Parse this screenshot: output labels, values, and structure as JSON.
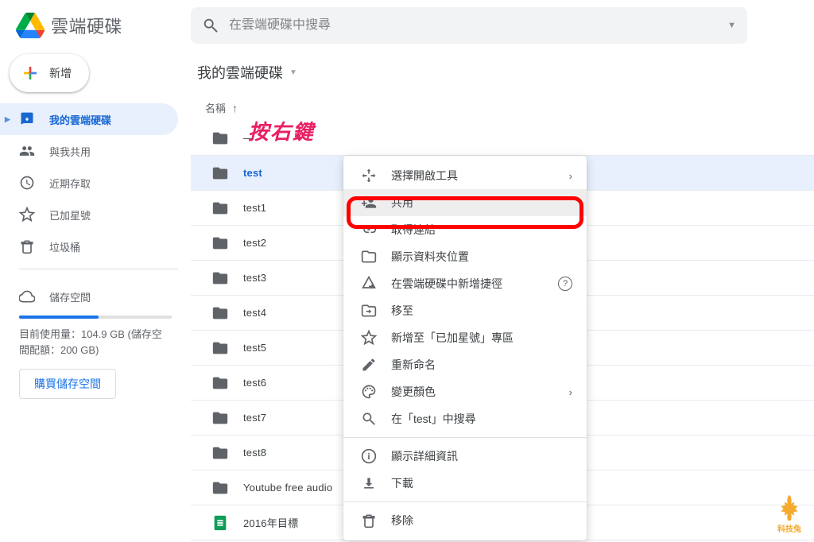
{
  "app_title": "雲端硬碟",
  "search": {
    "placeholder": "在雲端硬碟中搜尋"
  },
  "new_button_label": "新增",
  "sidebar": {
    "items": [
      {
        "label": "我的雲端硬碟"
      },
      {
        "label": "與我共用"
      },
      {
        "label": "近期存取"
      },
      {
        "label": "已加星號"
      },
      {
        "label": "垃圾桶"
      }
    ],
    "storage_label": "儲存空間",
    "storage_used_pct": 52,
    "storage_text": "目前使用量：104.9 GB (儲存空間配額：200 GB)",
    "buy_label": "購買儲存空間"
  },
  "main": {
    "path_title": "我的雲端硬碟",
    "column_name": "名稱",
    "sort_indicator": "↑",
    "files": [
      {
        "name": "—",
        "type": "folder"
      },
      {
        "name": "test",
        "type": "folder",
        "selected": true
      },
      {
        "name": "test1",
        "type": "folder"
      },
      {
        "name": "test2",
        "type": "folder"
      },
      {
        "name": "test3",
        "type": "folder"
      },
      {
        "name": "test4",
        "type": "folder"
      },
      {
        "name": "test5",
        "type": "folder"
      },
      {
        "name": "test6",
        "type": "folder"
      },
      {
        "name": "test7",
        "type": "folder"
      },
      {
        "name": "test8",
        "type": "folder"
      },
      {
        "name": "Youtube free audio",
        "type": "folder"
      },
      {
        "name": "2016年目標",
        "type": "sheets"
      }
    ]
  },
  "annotation_text": "按右鍵",
  "context_menu": {
    "items": [
      {
        "label": "選擇開啟工具",
        "icon": "open-with",
        "trailing": "chevron"
      },
      {
        "label": "共用",
        "icon": "person-add",
        "highlighted": true
      },
      {
        "label": "取得連結",
        "icon": "link"
      },
      {
        "label": "顯示資料夾位置",
        "icon": "folder-outline"
      },
      {
        "label": "在雲端硬碟中新增捷徑",
        "icon": "drive-shortcut",
        "trailing": "help"
      },
      {
        "label": "移至",
        "icon": "move-to"
      },
      {
        "label": "新增至「已加星號」專區",
        "icon": "star"
      },
      {
        "label": "重新命名",
        "icon": "rename"
      },
      {
        "label": "變更顏色",
        "icon": "palette",
        "trailing": "chevron"
      },
      {
        "label": "在「test」中搜尋",
        "icon": "search"
      },
      {
        "divider": true
      },
      {
        "label": "顯示詳細資訊",
        "icon": "info"
      },
      {
        "label": "下載",
        "icon": "download"
      },
      {
        "divider": true
      },
      {
        "label": "移除",
        "icon": "trash"
      }
    ]
  },
  "watermark_label": "科技兔"
}
